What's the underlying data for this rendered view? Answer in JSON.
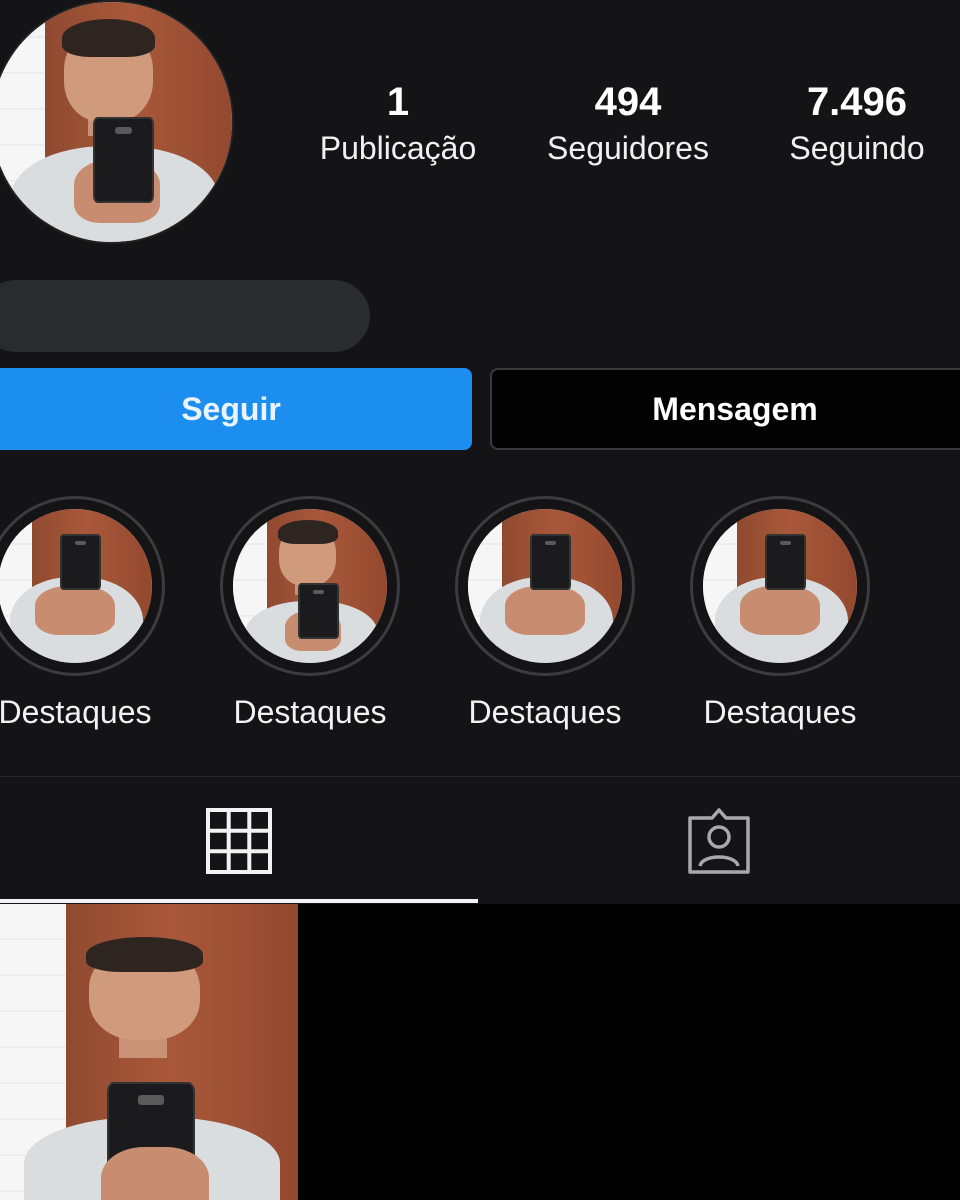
{
  "profile": {
    "stats": [
      {
        "value": "1",
        "label": "Publicação"
      },
      {
        "value": "494",
        "label": "Seguidores"
      },
      {
        "value": "7.496",
        "label": "Seguindo"
      }
    ]
  },
  "actions": {
    "follow_label": "Seguir",
    "message_label": "Mensagem"
  },
  "highlights": [
    {
      "label": "Destaques"
    },
    {
      "label": "Destaques"
    },
    {
      "label": "Destaques"
    },
    {
      "label": "Destaques"
    }
  ],
  "tabs": {
    "grid_icon": "grid-icon",
    "tagged_icon": "tagged-person-icon",
    "active": "grid"
  },
  "colors": {
    "background": "#141416",
    "follow_button": "#1c8ef0",
    "message_button": "#020203"
  }
}
